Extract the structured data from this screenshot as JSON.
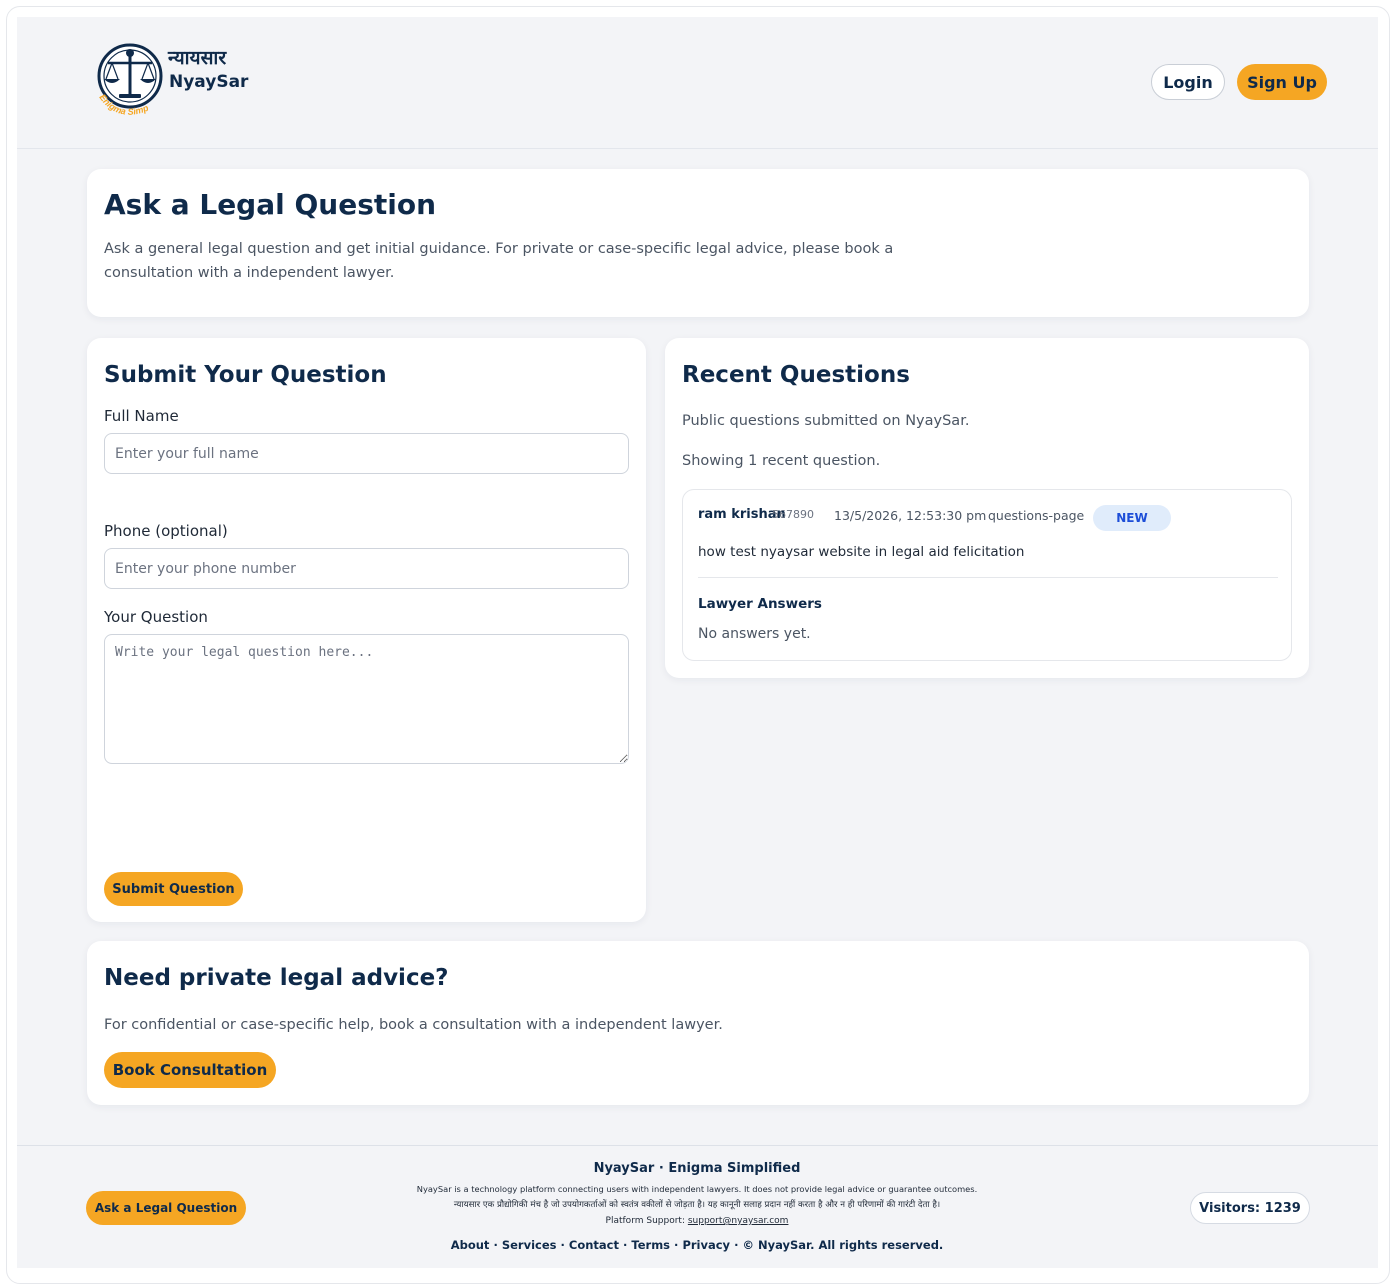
{
  "header": {
    "logo_hindi": "न्यायसार",
    "logo_english": "NyaySar",
    "logo_tagline": "Enigma Simplified",
    "login_label": "Login",
    "signup_label": "Sign Up"
  },
  "intro": {
    "title": "Ask a Legal Question",
    "description_line1": "Ask a general legal question and get initial guidance. For private or case-specific legal advice, please book a",
    "description_line2": "consultation with a independent lawyer."
  },
  "form": {
    "title": "Submit Your Question",
    "name_label": "Full Name",
    "name_placeholder": "Enter your full name",
    "phone_label": "Phone (optional)",
    "phone_placeholder": "Enter your phone number",
    "question_label": "Your Question",
    "question_placeholder": "Write your legal question here...",
    "submit_label": "Submit Question"
  },
  "recent": {
    "title": "Recent Questions",
    "subtitle": "Public questions submitted on NyaySar.",
    "count_text": "Showing 1 recent question.",
    "questions": [
      {
        "name": "ram krishan",
        "phone": "567890",
        "timestamp": "13/5/2026, 12:53:30 pm",
        "source": "questions-page",
        "badge": "NEW",
        "question": "how test nyaysar website in legal aid felicitation",
        "answers_heading": "Lawyer Answers",
        "answers_text": "No answers yet."
      }
    ]
  },
  "private_advice": {
    "title": "Need private legal advice?",
    "description": "For confidential or case-specific help, book a consultation with a independent lawyer.",
    "button_label": "Book Consultation"
  },
  "footer": {
    "ask_button": "Ask a Legal Question",
    "brand": "NyaySar · Enigma Simplified",
    "disclaimer_en": "NyaySar is a technology platform connecting users with independent lawyers. It does not provide legal advice or guarantee outcomes.",
    "disclaimer_hi": "न्यायसार एक प्रौद्योगिकी मंच है जो उपयोगकर्ताओं को स्वतंत्र वकीलों से जोड़ता है। यह कानूनी सलाह प्रदान नहीं करता है और न ही परिणामों की गारंटी देता है।",
    "support_label": "Platform Support:",
    "support_email": "support@nyaysar.com",
    "links": [
      "About",
      "Services",
      "Contact",
      "Terms",
      "Privacy"
    ],
    "separator": "·",
    "copyright": "© NyaySar. All rights reserved.",
    "visitors": "Visitors: 1239"
  },
  "colors": {
    "accent": "#f5a623",
    "navy": "#0f2a4a",
    "badge_bg": "#e0ecfb",
    "badge_text": "#1d4ed8",
    "page_bg": "#f3f4f7"
  }
}
